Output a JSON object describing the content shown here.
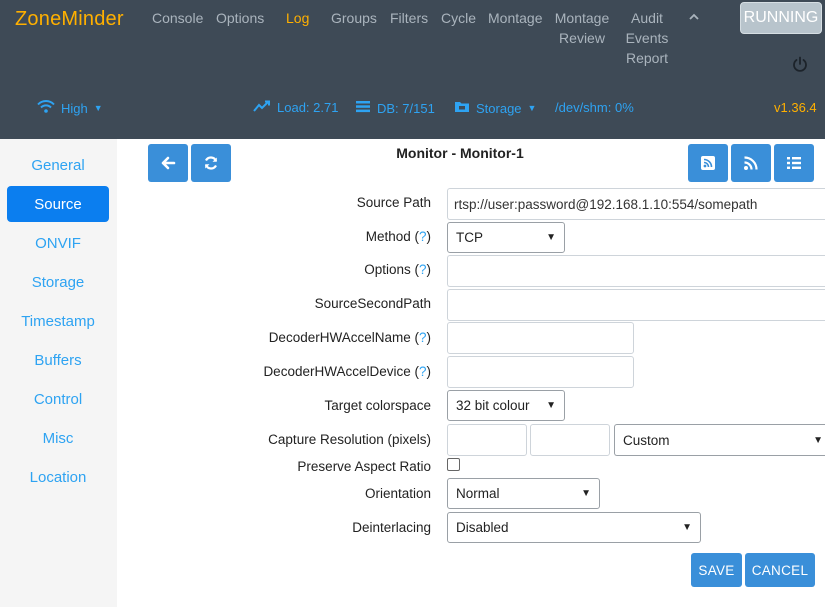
{
  "header": {
    "brand": "ZoneMinder",
    "nav": [
      {
        "label": "Console",
        "active": false
      },
      {
        "label": "Options",
        "active": false
      },
      {
        "label": "Log",
        "active": true
      },
      {
        "label": "Groups",
        "active": false
      },
      {
        "label": "Filters",
        "active": false
      },
      {
        "label": "Cycle",
        "active": false
      },
      {
        "label": "Montage",
        "active": false
      },
      {
        "label": "Montage Review",
        "active": false
      },
      {
        "label": "Audit Events Report",
        "active": false
      }
    ],
    "collapse_icon": "chevron-up-icon",
    "state_button": "RUNNING",
    "power_icon": "power-icon"
  },
  "status_bar": {
    "bandwidth": "High",
    "load": "Load: 2.71",
    "db": "DB: 7/151",
    "storage": "Storage",
    "shm": "/dev/shm: 0%",
    "version": "v1.36.4"
  },
  "sidebar": {
    "items": [
      {
        "label": "General",
        "active": false
      },
      {
        "label": "Source",
        "active": true
      },
      {
        "label": "ONVIF",
        "active": false
      },
      {
        "label": "Storage",
        "active": false
      },
      {
        "label": "Timestamp",
        "active": false
      },
      {
        "label": "Buffers",
        "active": false
      },
      {
        "label": "Control",
        "active": false
      },
      {
        "label": "Misc",
        "active": false
      },
      {
        "label": "Location",
        "active": false
      }
    ]
  },
  "page": {
    "title": "Monitor - Monitor-1"
  },
  "form": {
    "source_path": {
      "label": "Source Path",
      "value": "rtsp://user:password@192.168.1.10:554/somepath"
    },
    "method": {
      "label": "Method",
      "help": "?",
      "value": "TCP"
    },
    "options": {
      "label": "Options",
      "help": "?",
      "value": ""
    },
    "source_second_path": {
      "label": "SourceSecondPath",
      "value": ""
    },
    "decoder_hw_accel_name": {
      "label": "DecoderHWAccelName",
      "help": "?",
      "value": ""
    },
    "decoder_hw_accel_device": {
      "label": "DecoderHWAccelDevice",
      "help": "?",
      "value": ""
    },
    "target_colorspace": {
      "label": "Target colorspace",
      "value": "32 bit colour"
    },
    "capture_resolution": {
      "label": "Capture Resolution (pixels)",
      "width": "",
      "height": "",
      "preset": "Custom"
    },
    "preserve_aspect_ratio": {
      "label": "Preserve Aspect Ratio",
      "checked": false
    },
    "orientation": {
      "label": "Orientation",
      "value": "Normal"
    },
    "deinterlacing": {
      "label": "Deinterlacing",
      "value": "Disabled"
    }
  },
  "actions": {
    "save": "SAVE",
    "cancel": "CANCEL"
  },
  "colors": {
    "header_bg": "#3e4a56",
    "brand": "#ffb000",
    "accent": "#2ea3f2",
    "button": "#3a8fd9",
    "active_tab": "#0b7eef"
  }
}
